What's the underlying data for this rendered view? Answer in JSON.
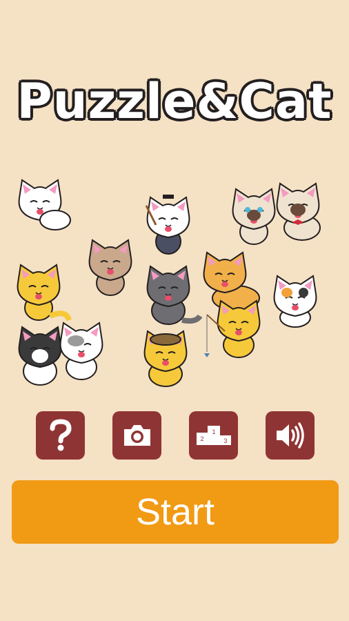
{
  "app": {
    "title_prefix": "Puzzle",
    "title_amp": "&",
    "title_suffix": "Cat"
  },
  "buttons": {
    "help": {
      "icon": "question-mark-icon"
    },
    "camera": {
      "icon": "camera-icon"
    },
    "ranking": {
      "icon": "podium-icon",
      "places": [
        "1",
        "2",
        "3"
      ]
    },
    "sound": {
      "icon": "speaker-icon"
    },
    "start_label": "Start"
  },
  "colors": {
    "background": "#f5e1c4",
    "icon_button": "#8f3434",
    "start_button": "#f19a14",
    "title_outline": "#231f20",
    "paw_pink": "#f07fb0"
  }
}
